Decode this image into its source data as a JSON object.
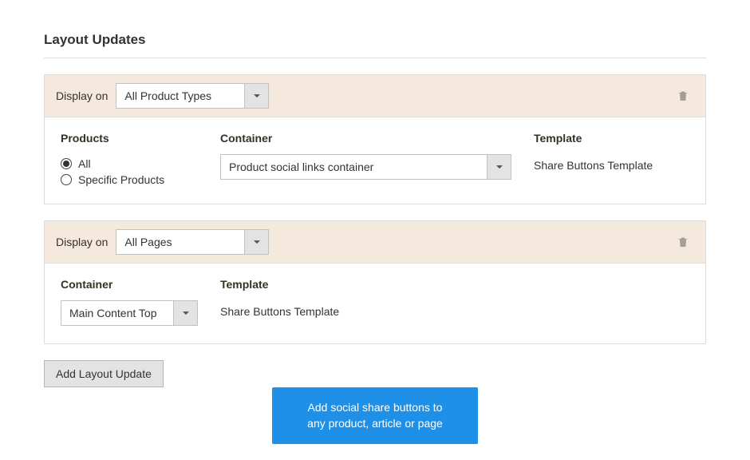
{
  "section_title": "Layout Updates",
  "updates": [
    {
      "display_on_label": "Display on",
      "display_on_value": "All Product Types",
      "products_label": "Products",
      "radio_all": "All",
      "radio_specific": "Specific Products",
      "radio_checked": "all",
      "container_label": "Container",
      "container_value": "Product social links container",
      "template_label": "Template",
      "template_value": "Share Buttons Template"
    },
    {
      "display_on_label": "Display on",
      "display_on_value": "All Pages",
      "container_label": "Container",
      "container_value": "Main Content Top",
      "template_label": "Template",
      "template_value": "Share Buttons Template"
    }
  ],
  "add_button_label": "Add Layout Update",
  "callout_line1": "Add social share buttons to",
  "callout_line2": "any product, article or page"
}
